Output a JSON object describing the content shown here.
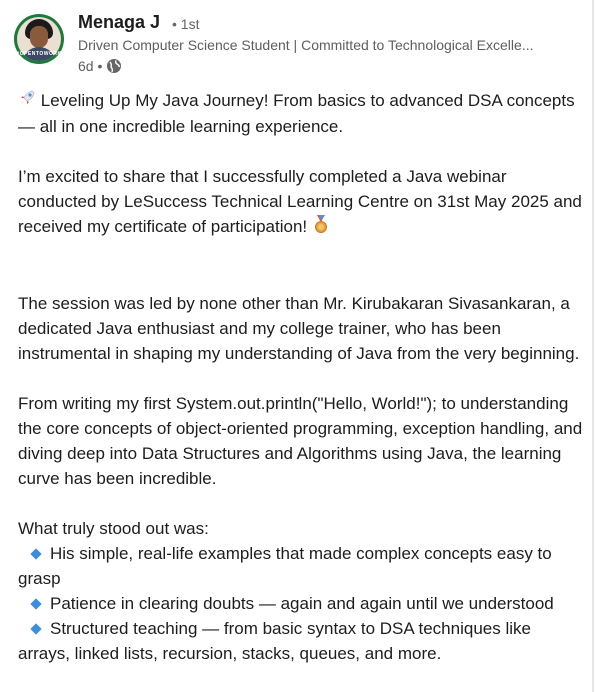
{
  "author": {
    "name": "Menaga J",
    "degree": "• 1st",
    "headline": "Driven Computer Science Student | Committed to Technological Excelle...",
    "time": "6d •",
    "avatar_badge": "#OPENTOWORK"
  },
  "post": {
    "intro": "Leveling Up My Java Journey! From basics to advanced DSA concepts — all in one incredible learning experience.",
    "para1": "I’m excited to share that I successfully completed a Java webinar conducted by LeSuccess Technical Learning Centre on 31st May 2025 and received my certificate of participation!",
    "para2": "The session was led by none other than Mr. Kirubakaran Sivasankaran, a dedicated Java enthusiast and my college trainer, who has been instrumental in shaping my understanding of Java from the very beginning.",
    "para3": "From writing my first System.out.println(\"Hello, World!\"); to understanding the core concepts of object-oriented programming, exception handling, and diving deep into Data Structures and Algorithms using Java, the learning curve has been incredible.",
    "standout": "What truly stood out was:",
    "bullets": [
      "His simple, real-life examples that made complex concepts easy to grasp",
      "Patience in clearing doubts — again and again until we understood",
      "Structured teaching — from basic syntax to DSA techniques like arrays, linked lists, recursion, stacks, queues, and more."
    ]
  },
  "icons": {
    "intro": "rocket-icon",
    "para1_end": "medal-icon",
    "bullet": "blue-diamond-icon",
    "visibility": "globe-icon"
  },
  "colors": {
    "bullet": "#3b8de0",
    "avatar_frame": "#1d7a3b",
    "secondary_text": "#5e5e5e"
  }
}
